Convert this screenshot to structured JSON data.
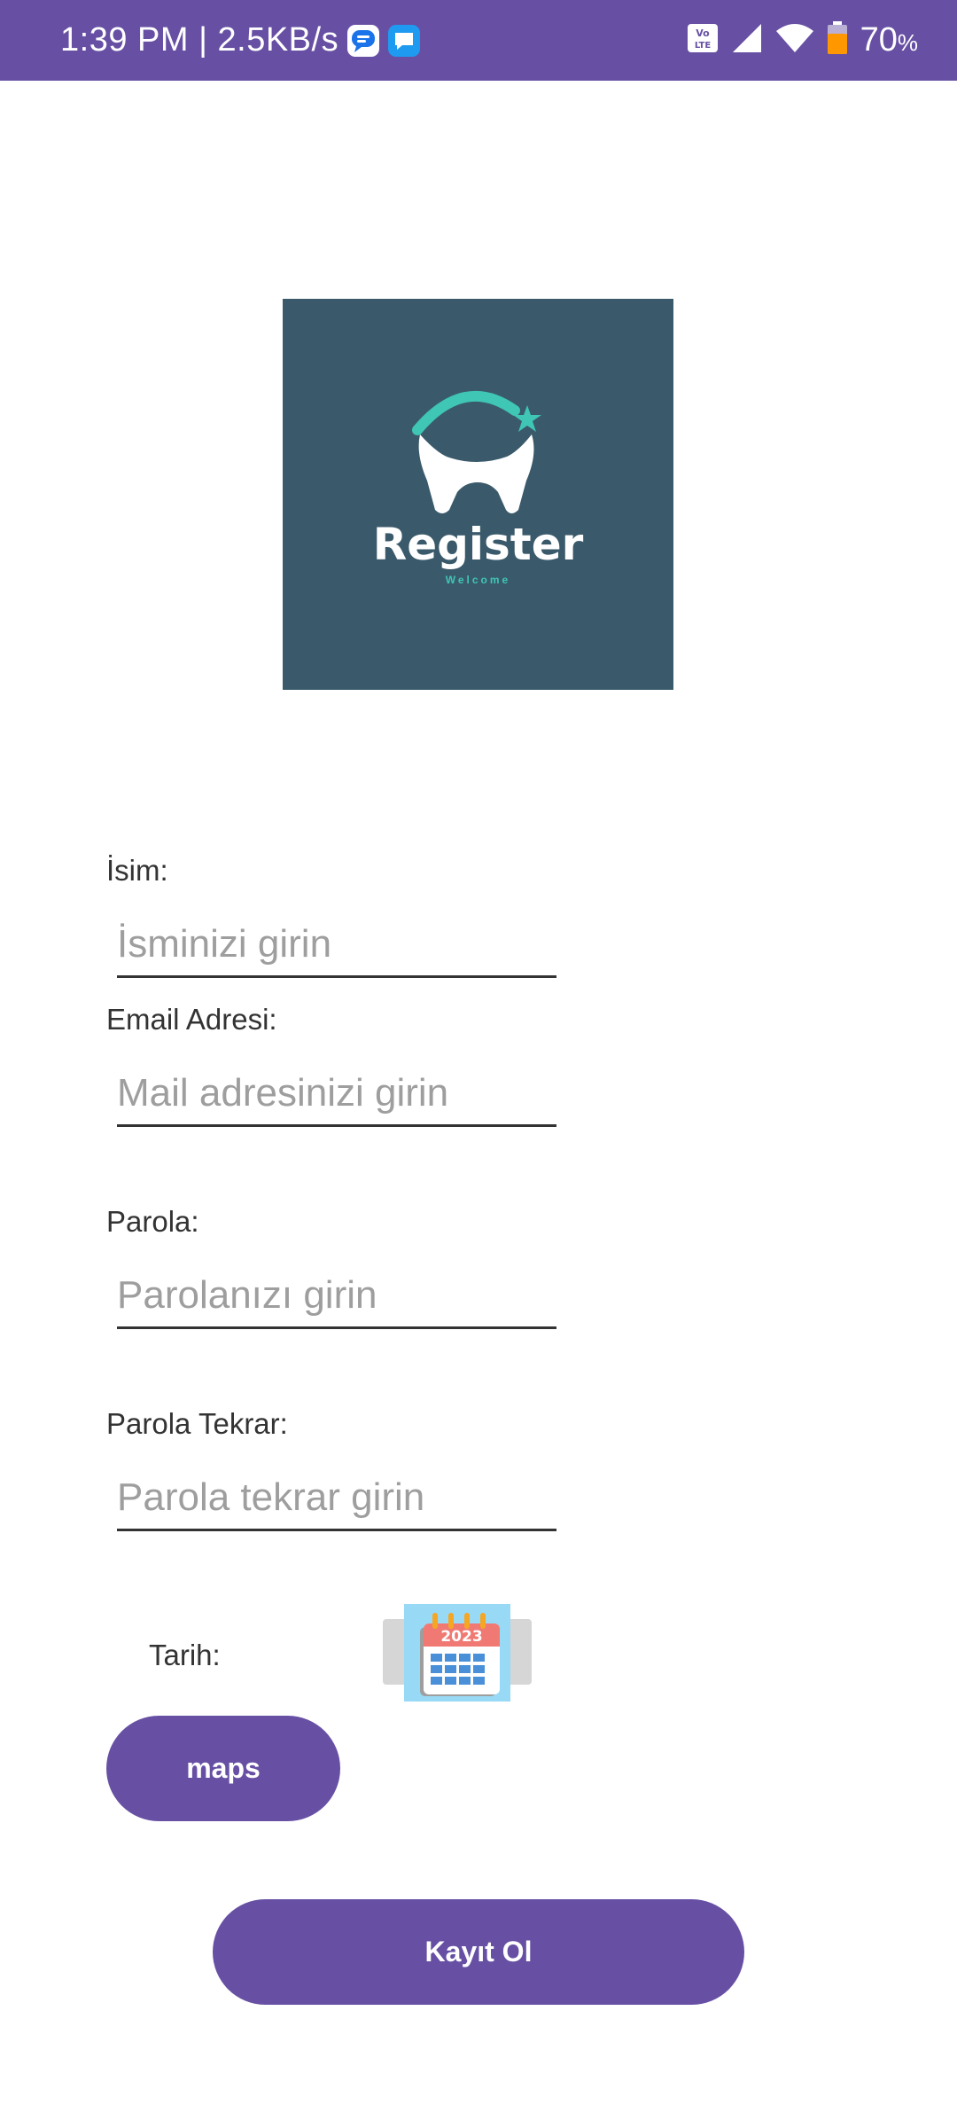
{
  "status_bar": {
    "time": "1:39 PM | 2.5KB/s",
    "battery": "70",
    "battery_unit": "%",
    "volte_label": "Vo LTE",
    "icons": [
      "message-icon",
      "chat-icon",
      "volte-icon",
      "signal-icon",
      "wifi-icon",
      "battery-icon"
    ]
  },
  "logo": {
    "title": "Register",
    "subtitle": "Welcome"
  },
  "form": {
    "name": {
      "label": "İsim:",
      "placeholder": "İsminizi girin"
    },
    "email": {
      "label": "Email Adresi:",
      "placeholder": "Mail adresinizi girin"
    },
    "password": {
      "label": "Parola:",
      "placeholder": "Parolanızı girin"
    },
    "password_repeat": {
      "label": "Parola Tekrar:",
      "placeholder": "Parola tekrar girin"
    },
    "date": {
      "label": "Tarih:",
      "calendar_year": "2023"
    }
  },
  "buttons": {
    "maps": "maps",
    "register": "Kayıt Ol"
  },
  "colors": {
    "primary": "#6750A4",
    "logo_bg": "#3A5A6B",
    "logo_accent": "#3FC6B5"
  }
}
